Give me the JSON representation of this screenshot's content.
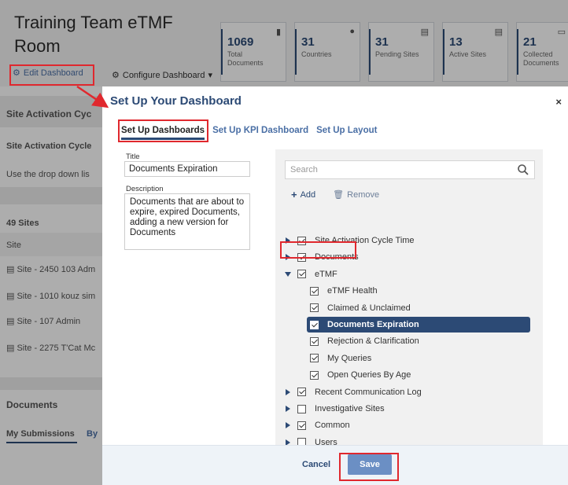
{
  "page": {
    "title": "Training Team eTMF Room",
    "edit_dashboard": "Edit Dashboard",
    "configure_dashboard": "Configure Dashboard"
  },
  "tiles": [
    {
      "value": "1069",
      "label": "Total Documents",
      "icon": "document-icon"
    },
    {
      "value": "31",
      "label": "Countries",
      "icon": "globe-icon"
    },
    {
      "value": "31",
      "label": "Pending Sites",
      "icon": "building-icon"
    },
    {
      "value": "13",
      "label": "Active Sites",
      "icon": "building-icon"
    },
    {
      "value": "21",
      "label": "Collected Documents",
      "icon": "inbox-icon"
    }
  ],
  "sidebar": {
    "section1": "Site Activation Cyc",
    "section1_tab": "Site Activation Cycle",
    "hint": "Use the drop down lis",
    "sites_count": "49 Sites",
    "site_header": "Site",
    "sites": [
      "Site - 2450 103 Adm",
      "Site - 1010 kouz sim",
      "Site - 107 Admin",
      "Site - 2275 T'Cat Mc"
    ],
    "documents": "Documents",
    "my_submissions": "My Submissions",
    "by": "By"
  },
  "modal": {
    "title": "Set Up Your Dashboard",
    "close": "×",
    "tabs": [
      "Set Up Dashboards",
      "Set Up KPI Dashboard",
      "Set Up Layout"
    ],
    "title_label": "Title",
    "title_value": "Documents Expiration",
    "description_label": "Description",
    "description_value": "Documents that are about to expire, expired Documents, adding a new version for Documents",
    "search_placeholder": "Search",
    "add": "Add",
    "remove": "Remove",
    "tree": [
      {
        "label": "Site Activation Cycle Time",
        "level": 0,
        "checked": true,
        "expanded": false
      },
      {
        "label": "Documents",
        "level": 0,
        "checked": true,
        "expanded": false
      },
      {
        "label": "eTMF",
        "level": 0,
        "checked": true,
        "expanded": true
      },
      {
        "label": "eTMF Health",
        "level": 1,
        "checked": true
      },
      {
        "label": "Claimed & Unclaimed",
        "level": 1,
        "checked": true
      },
      {
        "label": "Documents Expiration",
        "level": 1,
        "checked": true,
        "selected": true
      },
      {
        "label": "Rejection & Clarification",
        "level": 1,
        "checked": true
      },
      {
        "label": "My Queries",
        "level": 1,
        "checked": true
      },
      {
        "label": "Open Queries By Age",
        "level": 1,
        "checked": true
      },
      {
        "label": "Recent Communication Log",
        "level": 0,
        "checked": true,
        "expanded": false
      },
      {
        "label": "Investigative Sites",
        "level": 0,
        "checked": false,
        "expanded": false
      },
      {
        "label": "Common",
        "level": 0,
        "checked": true,
        "expanded": false
      },
      {
        "label": "Users",
        "level": 0,
        "checked": false,
        "expanded": false
      }
    ],
    "cancel": "Cancel",
    "save": "Save"
  },
  "colors": {
    "brand": "#2c4a75",
    "annotation": "#e0282e",
    "save_button": "#6b8fc4"
  }
}
